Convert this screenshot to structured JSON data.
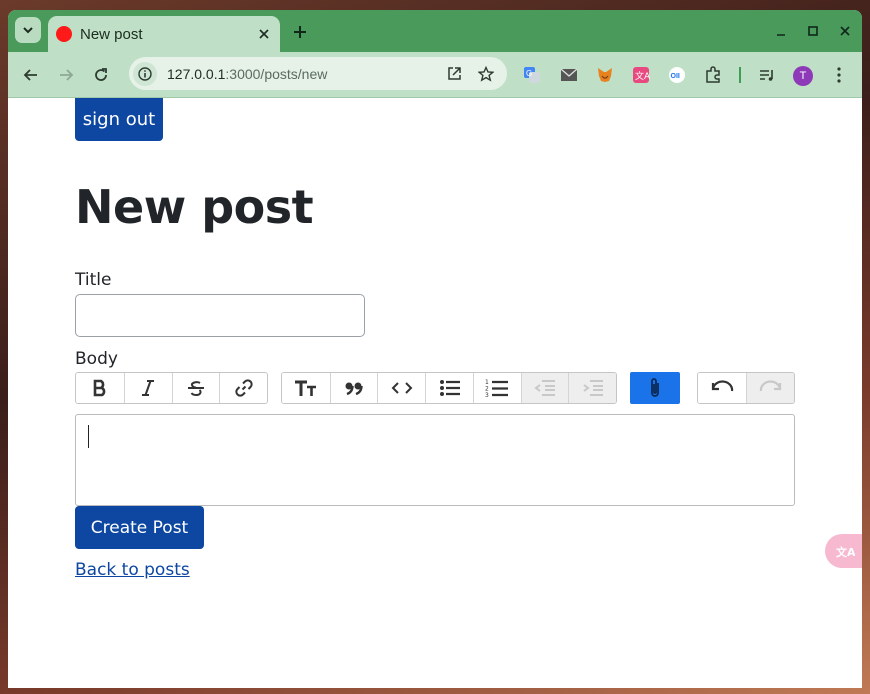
{
  "browser": {
    "tab_title": "New post",
    "url_host": "127.0.0.1",
    "url_rest": ":3000/posts/new",
    "profile_initial": "T"
  },
  "page": {
    "sign_out_label": "sign out",
    "heading": "New post",
    "title_label": "Title",
    "title_value": "",
    "body_label": "Body",
    "create_button_label": "Create Post",
    "back_link_label": "Back to posts"
  },
  "editor_toolbar": {
    "text_tools": [
      "bold-icon",
      "italic-icon",
      "strikethrough-icon",
      "link-icon"
    ],
    "block_tools": [
      "heading-icon",
      "quote-icon",
      "code-icon",
      "bullet-list-icon",
      "numbered-list-icon",
      "decrease-indent-icon",
      "increase-indent-icon"
    ],
    "file_tools": [
      "attach-files-icon"
    ],
    "history_tools": [
      "undo-icon",
      "redo-icon"
    ]
  },
  "colors": {
    "primary": "#0d47a1",
    "attach": "#1a73e8",
    "browser_frame": "#4a9a5c",
    "browser_toolbar": "#bfe0c6"
  }
}
